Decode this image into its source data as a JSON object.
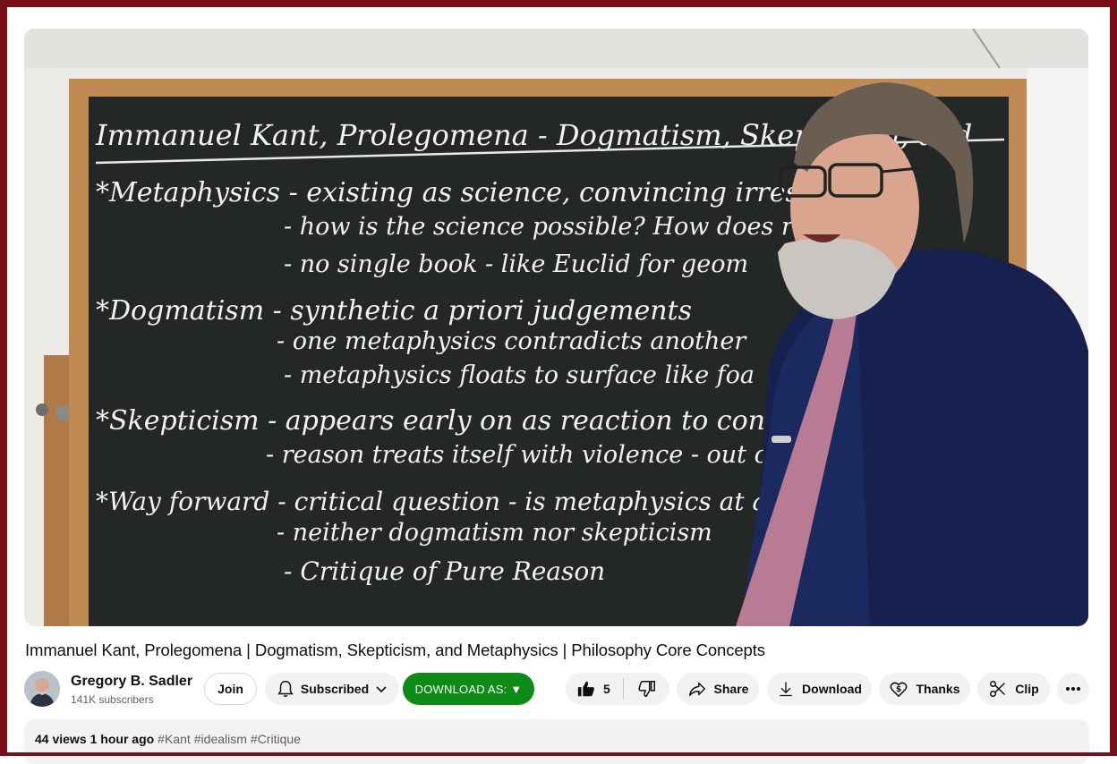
{
  "video": {
    "board_lines": [
      "Immanuel Kant, Prolegomena - Dogmatism, Skepticism, and",
      "*Metaphysics - existing as science, convincing irrestably",
      "- how is the science possible? How does reason",
      "- no single book - like Euclid for geom",
      "*Dogmatism - synthetic a priori judgements",
      "- one metaphysics contradicts another",
      "- metaphysics floats to surface like foa",
      "*Skepticism - appears early on as reaction to contradict",
      "- reason treats itself with violence - out of d",
      "*Way forward - critical question - is metaphysics at all poss",
      "- neither dogmatism nor skepticism",
      "- Critique of Pure Reason"
    ]
  },
  "title": "Immanuel Kant, Prolegomena | Dogmatism, Skepticism, and Metaphysics | Philosophy Core Concepts",
  "channel": {
    "name": "Gregory B. Sadler",
    "subscribers": "141K subscribers"
  },
  "actions": {
    "join": "Join",
    "subscribed": "Subscribed",
    "download_as": "DOWNLOAD AS: ▼",
    "likes": "5",
    "share": "Share",
    "download": "Download",
    "thanks": "Thanks",
    "clip": "Clip"
  },
  "description": {
    "views": "44 views",
    "age": "1 hour ago",
    "tags": [
      "#Kant",
      "#idealism",
      "#Critique"
    ]
  },
  "colors": {
    "frame": "#7a0f1a",
    "download_as_bg": "#0e8a16",
    "pill_bg": "#f2f2f2"
  }
}
